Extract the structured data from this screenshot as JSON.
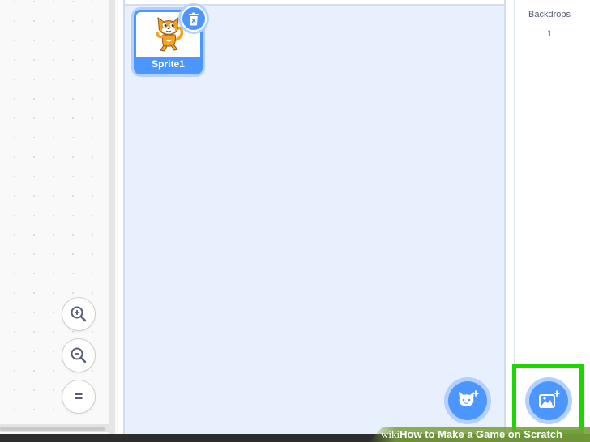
{
  "code_area": {
    "zoom_in_icon": "zoom-in-icon",
    "zoom_out_icon": "zoom-out-icon",
    "zoom_reset_label": "="
  },
  "sprite_pane": {
    "sprites": [
      {
        "name": "Sprite1",
        "selected": true,
        "icon": "cat-sprite"
      }
    ],
    "delete_icon": "trash-icon",
    "choose_sprite_icon": "cat-plus-icon"
  },
  "stage": {
    "backdrops_label": "Backdrops",
    "backdrops_count": "1",
    "choose_backdrop_icon": "image-plus-icon"
  },
  "watermark": {
    "wiki": "wiki",
    "how": "How",
    "rest": " to Make a Game on Scratch"
  },
  "colors": {
    "accent": "#4c97ff",
    "accent_glow": "#b3d0ff",
    "sprite_pane_bg": "#e8f0fd",
    "highlight": "#1bd600"
  }
}
